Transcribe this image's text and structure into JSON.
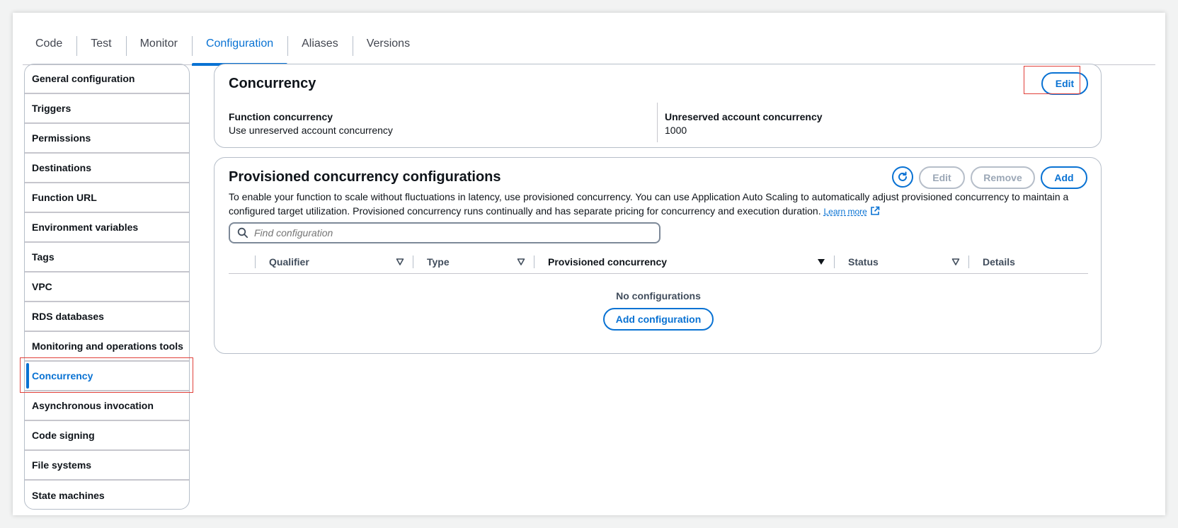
{
  "tabs": [
    {
      "label": "Code"
    },
    {
      "label": "Test"
    },
    {
      "label": "Monitor"
    },
    {
      "label": "Configuration"
    },
    {
      "label": "Aliases"
    },
    {
      "label": "Versions"
    }
  ],
  "sidebar": {
    "items": [
      {
        "label": "General configuration"
      },
      {
        "label": "Triggers"
      },
      {
        "label": "Permissions"
      },
      {
        "label": "Destinations"
      },
      {
        "label": "Function URL"
      },
      {
        "label": "Environment variables"
      },
      {
        "label": "Tags"
      },
      {
        "label": "VPC"
      },
      {
        "label": "RDS databases"
      },
      {
        "label": "Monitoring and operations tools"
      },
      {
        "label": "Concurrency"
      },
      {
        "label": "Asynchronous invocation"
      },
      {
        "label": "Code signing"
      },
      {
        "label": "File systems"
      },
      {
        "label": "State machines"
      }
    ]
  },
  "concurrency": {
    "title": "Concurrency",
    "edit_label": "Edit",
    "function_concurrency_label": "Function concurrency",
    "function_concurrency_value": "Use unreserved account concurrency",
    "unreserved_label": "Unreserved account concurrency",
    "unreserved_value": "1000"
  },
  "provisioned": {
    "title": "Provisioned concurrency configurations",
    "edit_label": "Edit",
    "remove_label": "Remove",
    "add_label": "Add",
    "description": "To enable your function to scale without fluctuations in latency, use provisioned concurrency. You can use Application Auto Scaling to automatically adjust provisioned concurrency to maintain a configured target utilization. Provisioned concurrency runs continually and has separate pricing for concurrency and execution duration.",
    "learn_more": "Learn more",
    "search_placeholder": "Find configuration",
    "columns": {
      "qualifier": "Qualifier",
      "type": "Type",
      "provisioned": "Provisioned concurrency",
      "status": "Status",
      "details": "Details"
    },
    "empty_text": "No configurations",
    "add_config_label": "Add configuration"
  },
  "colors": {
    "accent": "#0972d3",
    "highlight": "#e0403a"
  }
}
